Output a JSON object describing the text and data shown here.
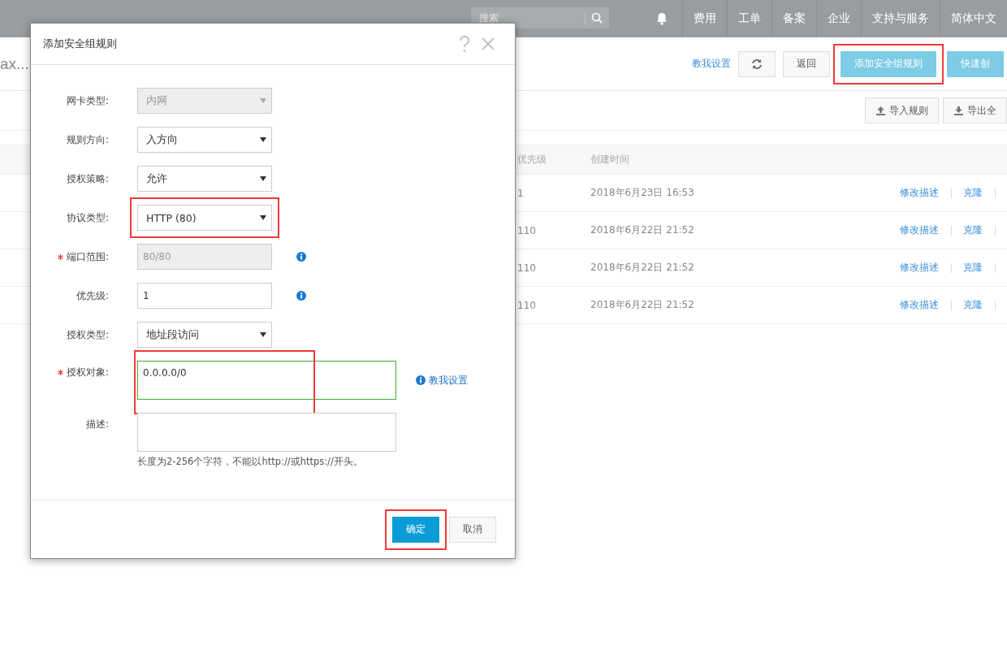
{
  "topbar": {
    "search": {
      "placeholder": "搜索"
    },
    "nav": [
      "费用",
      "工单",
      "备案",
      "企业",
      "支持与服务",
      "简体中文"
    ]
  },
  "page": {
    "title": "ax...",
    "help_link": "教我设置",
    "actions": [
      {
        "kind": "refresh"
      },
      {
        "kind": "default",
        "label": "返回"
      },
      {
        "kind": "primary",
        "label": "添加安全组规则",
        "highlighted": true
      },
      {
        "kind": "primary",
        "label": "快速创"
      }
    ],
    "tools": [
      {
        "kind": "import",
        "label": "导入规则"
      },
      {
        "kind": "export",
        "label": "导出全"
      }
    ]
  },
  "table": {
    "columns": [
      "优先级",
      "创建时间"
    ],
    "rows": [
      {
        "priority": "1",
        "created": "2018年6月23日 16:53",
        "actions": [
          "修改描述",
          "克隆"
        ]
      },
      {
        "priority": "110",
        "created": "2018年6月22日 21:52",
        "actions": [
          "修改描述",
          "克隆"
        ]
      },
      {
        "priority": "110",
        "created": "2018年6月22日 21:52",
        "actions": [
          "修改描述",
          "克隆"
        ]
      },
      {
        "priority": "110",
        "created": "2018年6月22日 21:52",
        "actions": [
          "修改描述",
          "克隆"
        ]
      }
    ]
  },
  "dialog": {
    "title": "添加安全组规则",
    "fields": [
      {
        "kind": "select",
        "label": "网卡类型:",
        "value": "内网",
        "disabled": true
      },
      {
        "kind": "select",
        "label": "规则方向:",
        "value": "入方向"
      },
      {
        "kind": "select",
        "label": "授权策略:",
        "value": "允许"
      },
      {
        "kind": "select",
        "label": "协议类型:",
        "value": "HTTP (80)",
        "highlighted": true
      },
      {
        "kind": "input",
        "label": "端口范围:",
        "value": "80/80",
        "disabled": true,
        "required": true,
        "info": true
      },
      {
        "kind": "input",
        "label": "优先级:",
        "value": "1",
        "info": true
      },
      {
        "kind": "select",
        "label": "授权类型:",
        "value": "地址段访问"
      },
      {
        "kind": "textarea",
        "label": "授权对象:",
        "value": "0.0.0.0/0",
        "required": true,
        "valid": true,
        "highlighted": true,
        "link": "教我设置"
      },
      {
        "kind": "textarea",
        "label": "描述:",
        "hint": "长度为2-256个字符，不能以http://或https://开头。"
      }
    ],
    "buttons": [
      {
        "kind": "primary",
        "label": "确定",
        "highlighted": true
      },
      {
        "kind": "default",
        "label": "取消"
      }
    ]
  }
}
